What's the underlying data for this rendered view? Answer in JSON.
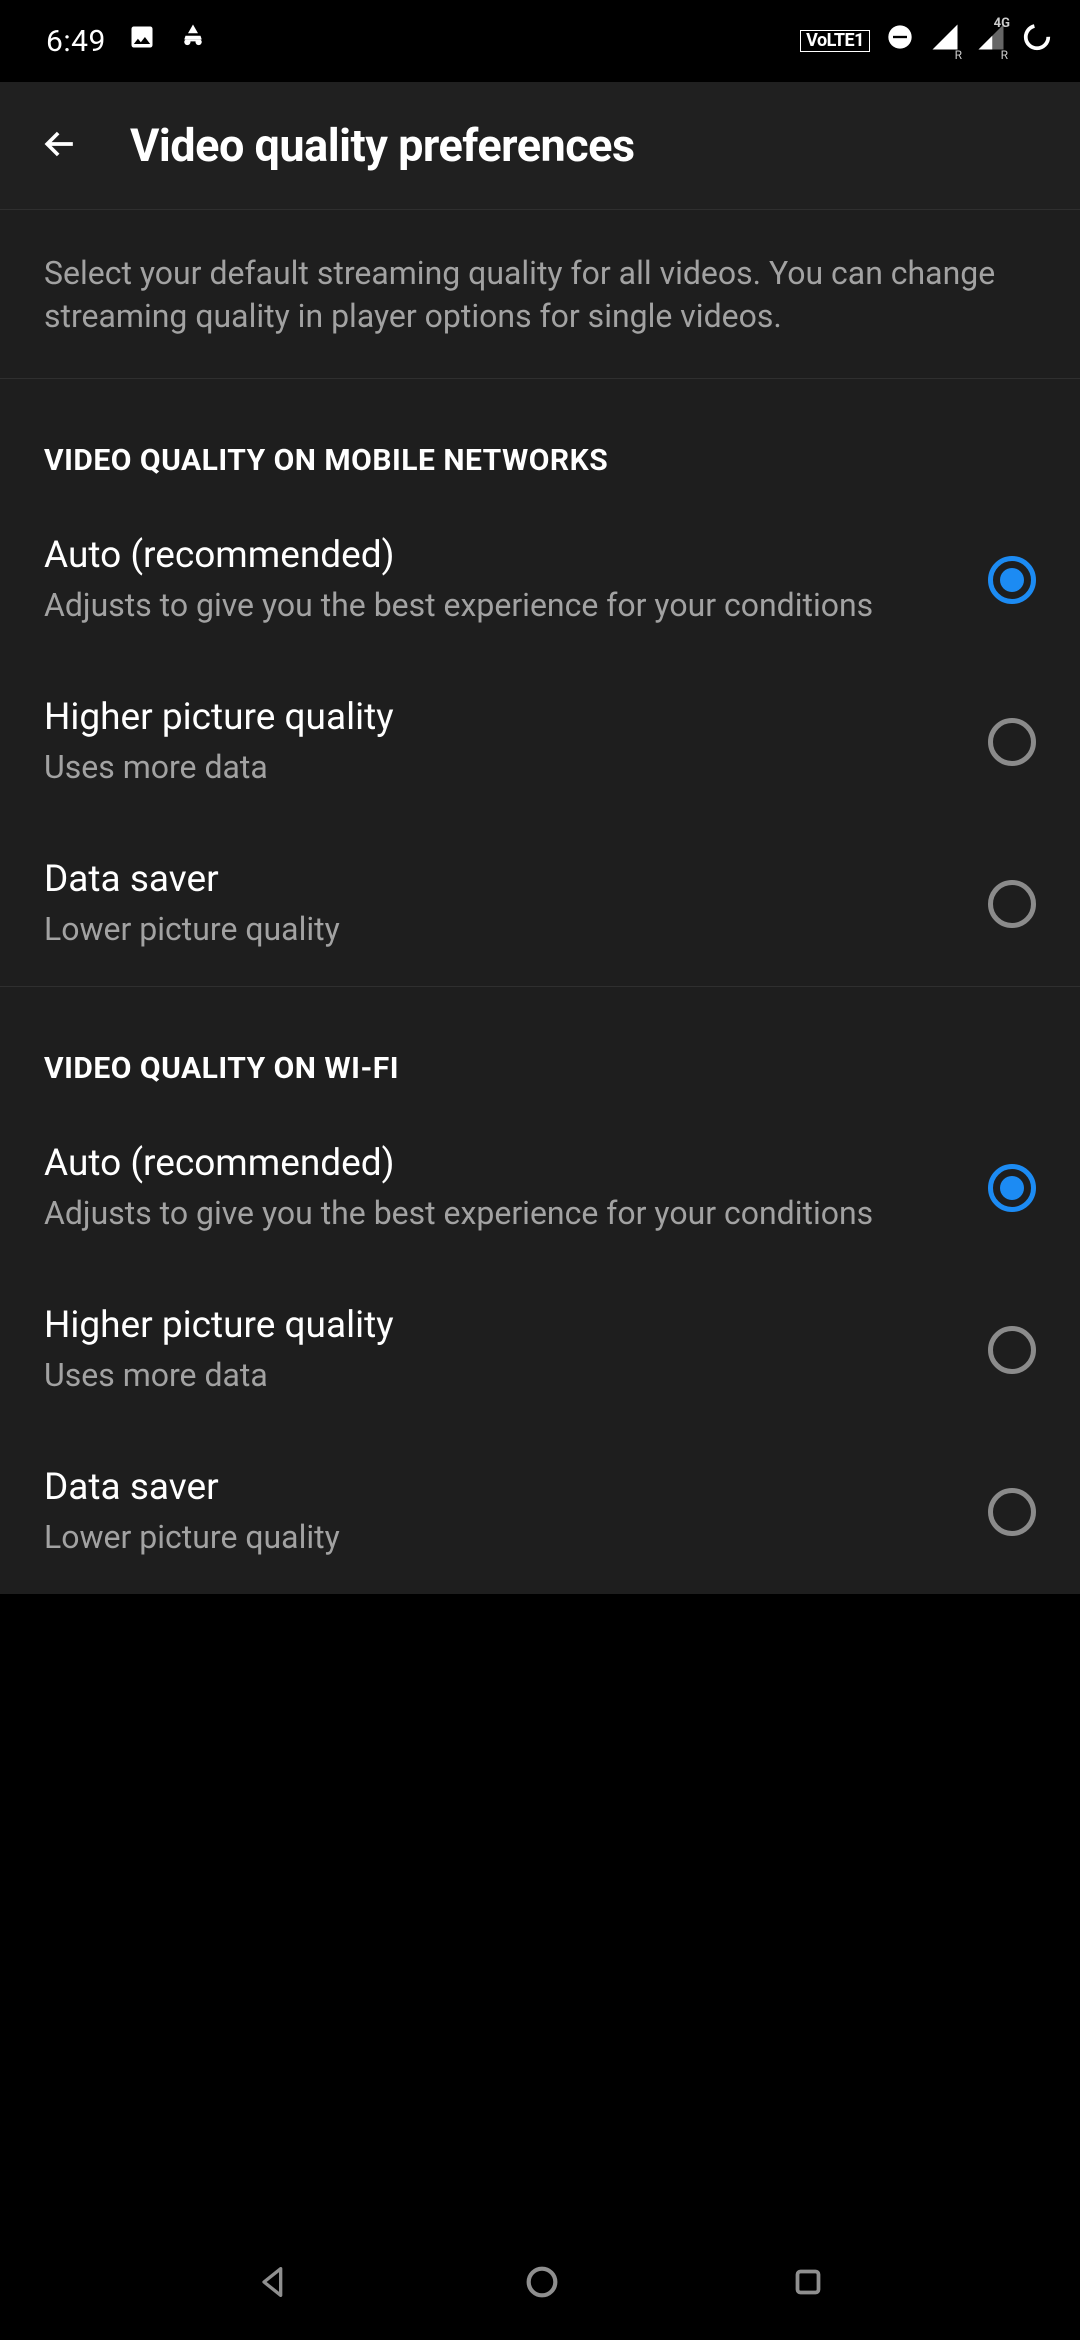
{
  "status": {
    "time": "6:49",
    "volte": "VoLTE1",
    "sig_sub": "R",
    "sig2_sub": "R",
    "sig2_top": "4G"
  },
  "appbar": {
    "title": "Video quality preferences"
  },
  "intro": "Select your default streaming quality for all videos. You can change streaming quality in player options for single videos.",
  "sections": [
    {
      "header": "VIDEO QUALITY ON MOBILE NETWORKS",
      "options": [
        {
          "title": "Auto (recommended)",
          "sub": "Adjusts to give you the best experience for your conditions",
          "selected": true
        },
        {
          "title": "Higher picture quality",
          "sub": "Uses more data",
          "selected": false
        },
        {
          "title": "Data saver",
          "sub": "Lower picture quality",
          "selected": false
        }
      ]
    },
    {
      "header": "VIDEO QUALITY ON WI-FI",
      "options": [
        {
          "title": "Auto (recommended)",
          "sub": "Adjusts to give you the best experience for your conditions",
          "selected": true
        },
        {
          "title": "Higher picture quality",
          "sub": "Uses more data",
          "selected": false
        },
        {
          "title": "Data saver",
          "sub": "Lower picture quality",
          "selected": false
        }
      ]
    }
  ]
}
